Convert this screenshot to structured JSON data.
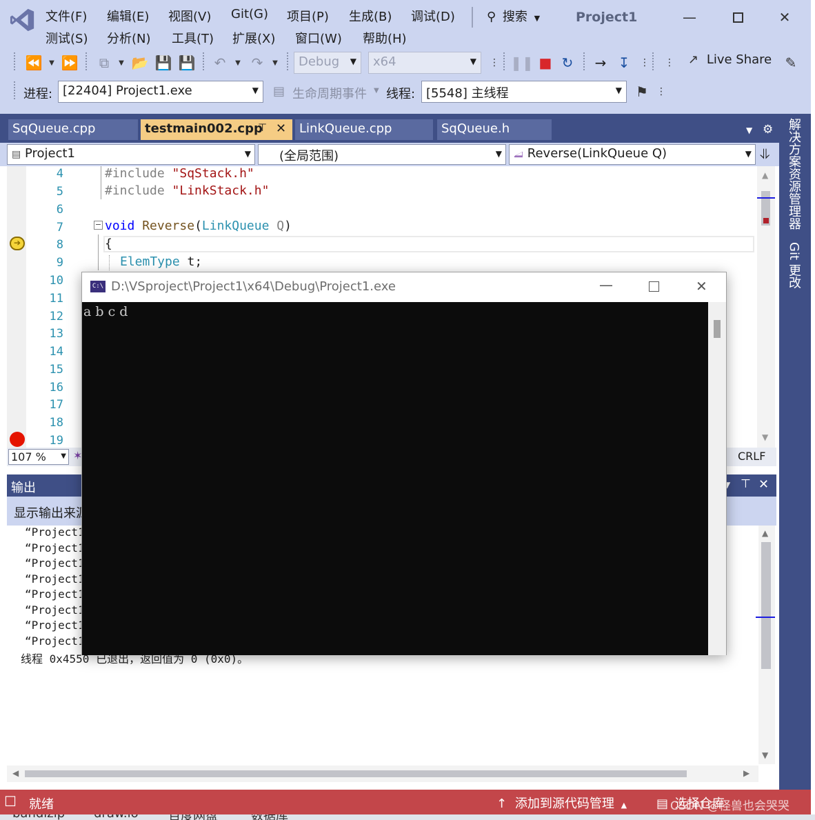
{
  "window": {
    "project_title": "Project1",
    "search_label": "搜索"
  },
  "menu": {
    "row1": [
      "文件(F)",
      "编辑(E)",
      "视图(V)",
      "Git(G)",
      "项目(P)",
      "生成(B)",
      "调试(D)"
    ],
    "row2": [
      "测试(S)",
      "分析(N)",
      "工具(T)",
      "扩展(X)",
      "窗口(W)",
      "帮助(H)"
    ]
  },
  "toolbar": {
    "config": "Debug",
    "platform": "x64",
    "live_share": "Live Share"
  },
  "debug_bar": {
    "process_label": "进程:",
    "process_value": "[22404] Project1.exe",
    "lifecycle_label": "生命周期事件",
    "thread_label": "线程:",
    "thread_value": "[5548] 主线程"
  },
  "tabs": [
    {
      "label": "SqQueue.cpp"
    },
    {
      "label": "testmain002.cpp"
    },
    {
      "label": "LinkQueue.cpp"
    },
    {
      "label": "SqQueue.h"
    }
  ],
  "navbar": {
    "project": "Project1",
    "scope": "(全局范围)",
    "member": "Reverse(LinkQueue Q)"
  },
  "side_panels": {
    "solution_explorer": "解决方案资源管理器",
    "git_changes": "Git 更改"
  },
  "editor": {
    "line_numbers": [
      "4",
      "5",
      "6",
      "7",
      "8",
      "9",
      "10",
      "11",
      "12",
      "13",
      "14",
      "15",
      "16",
      "17",
      "18",
      "19"
    ],
    "line4": {
      "directive": "#include",
      "file": "\"SqStack.h\""
    },
    "line5": {
      "directive": "#include",
      "file": "\"LinkStack.h\""
    },
    "line7": {
      "kw": "void",
      "fn": "Reverse",
      "open": "(",
      "type": "LinkQueue",
      "param": "Q",
      "close": ")"
    },
    "line8": "{",
    "line9": {
      "type": "ElemType",
      "rest": "t;"
    },
    "zoom": "107 %",
    "line_ending": "CRLF"
  },
  "output": {
    "title": "输出",
    "source_label": "显示输出来源",
    "lines": [
      "“Project1",
      "“Project1",
      "“Project1",
      "“Project1",
      "“Project1",
      "“Project1",
      "“Project1",
      "“Project1"
    ],
    "last_line": "线程 0x4550 已退出，返回值为 0 (0x0)。"
  },
  "console": {
    "title": "D:\\VSproject\\Project1\\x64\\Debug\\Project1.exe",
    "icon_text": "C:\\",
    "output": "a b c d"
  },
  "statusbar": {
    "ready": "就绪",
    "add_source_control": "添加到源代码管理",
    "select_repo": "选择仓库",
    "watermark": "CSDN @怪兽也会哭哭"
  },
  "taskbar": [
    "bandizip",
    "draw.io",
    "百度网盘",
    "数据库"
  ]
}
